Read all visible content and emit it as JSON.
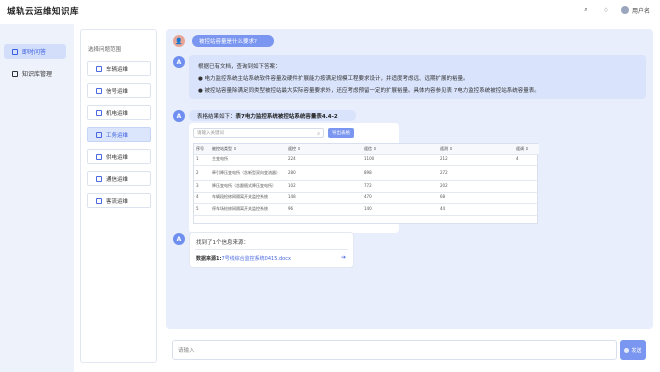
{
  "app": {
    "title": "城轨云运维知识库"
  },
  "header": {
    "user_name": "用户名"
  },
  "nav": {
    "items": [
      {
        "label": "即时问答",
        "active": true
      },
      {
        "label": "知识库管理",
        "active": false
      }
    ]
  },
  "scope": {
    "title": "选择问题范围",
    "items": [
      {
        "label": "车辆运维",
        "active": false
      },
      {
        "label": "信号运维",
        "active": false
      },
      {
        "label": "机电运维",
        "active": false
      },
      {
        "label": "工务运维",
        "active": true
      },
      {
        "label": "供电运维",
        "active": false
      },
      {
        "label": "通信运维",
        "active": false
      },
      {
        "label": "客流运维",
        "active": false
      }
    ]
  },
  "chat": {
    "question": "被控站容量是什么要求?",
    "answer1": {
      "line1": "根据已有文档，查询到如下答案：",
      "line2": "● 电力监控系统主站系统软件容量及硬件扩展能力按满足规模工程要求设计，并适度考虑远、远期扩展的裕量。",
      "line3": "● 被控站容量除满足同类型被控站最大实际容量要求外，还应考虑预留一定的扩展裕量。具体内容参见表 7电力监控系统被控站系统容量表。"
    },
    "answer2": {
      "prefix": "表格结果如下：",
      "table_title": "表7电力监控系统被控站系统容量表4.4-2",
      "search_placeholder": "请输入关键词",
      "export_label": "导出表格",
      "columns": [
        "序号",
        "被控站类型 ⇕",
        "遥控 ⇕",
        "遥信 ⇕",
        "遥测 ⇕",
        "遥调 ⇕"
      ],
      "rows": [
        [
          "1",
          "主变电所",
          "224",
          "1100",
          "212",
          "4"
        ],
        [
          "2",
          "牵引降压变电所（含新型双向变流器）",
          "280",
          "898",
          "272",
          ""
        ],
        [
          "3",
          "降压变电所（含跟随式降压变电所）",
          "102",
          "772",
          "202",
          ""
        ],
        [
          "4",
          "车辆段检修网隔离开关监控系统",
          "148",
          "470",
          "68",
          ""
        ],
        [
          "5",
          "停车场检修网隔离开关监控系统",
          "96",
          "140",
          "44",
          ""
        ]
      ]
    },
    "answer3": {
      "title": "找到了1个信息来源：",
      "source_label": "数据来源1:",
      "source_link": "7号线综合监控系统0415.docx"
    }
  },
  "composer": {
    "placeholder": "请输入",
    "send_label": "发送"
  }
}
